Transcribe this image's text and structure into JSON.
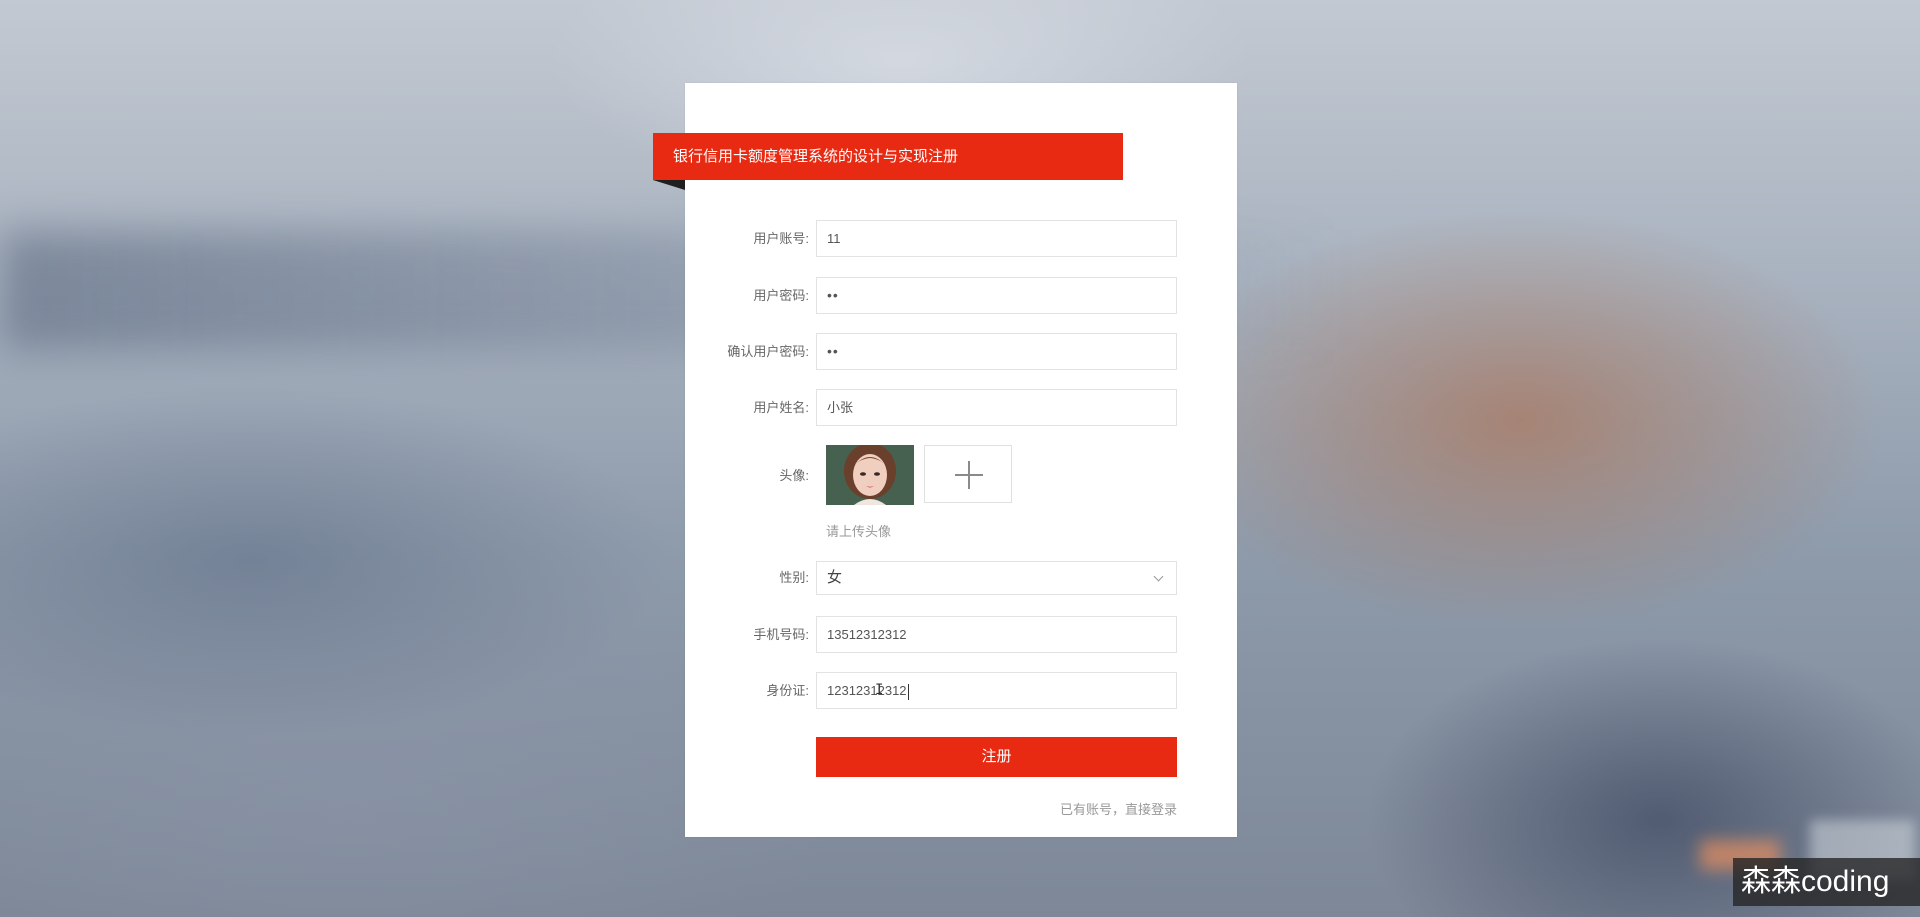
{
  "form": {
    "title": "银行信用卡额度管理系统的设计与实现注册",
    "fields": [
      {
        "label": "用户账号:",
        "value": "11"
      },
      {
        "label": "用户密码:",
        "value": "••"
      },
      {
        "label": "确认用户密码:",
        "value": "••"
      },
      {
        "label": "用户姓名:",
        "value": "小张"
      }
    ],
    "avatar": {
      "label": "头像:",
      "hint": "请上传头像"
    },
    "gender": {
      "label": "性别:",
      "value": "女"
    },
    "phone": {
      "label": "手机号码:",
      "value": "13512312312"
    },
    "id_card": {
      "label": "身份证:",
      "value": "12312312312"
    },
    "submit_label": "注册",
    "login_link": "已有账号，直接登录"
  },
  "watermark": "森森coding",
  "colors": {
    "accent": "#e82a12",
    "card": "#ffffff"
  }
}
